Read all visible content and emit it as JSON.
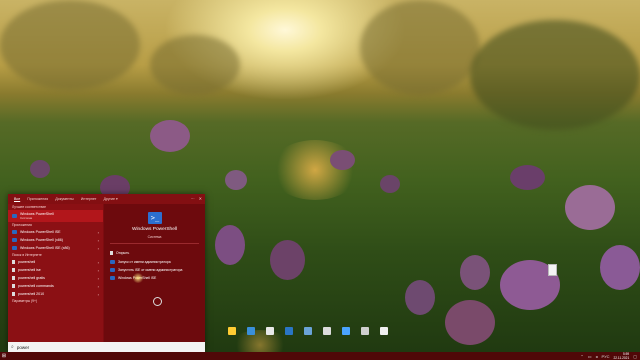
{
  "start_menu": {
    "tabs": [
      "Все",
      "Приложения",
      "Документы",
      "Интернет",
      "Другие ▾"
    ],
    "sections": {
      "best_match": "Лучшее соответствие",
      "apps": "Приложения",
      "web": "Поиск в Интернете",
      "settings": "Параметры (9+)"
    },
    "best_match": {
      "name": "Windows PowerShell",
      "type": "Система"
    },
    "apps": [
      "Windows PowerShell ISE",
      "Windows PowerShell (x86)",
      "Windows PowerShell ISE (x86)"
    ],
    "web": [
      "powershell",
      "powershell ise",
      "powershell gratis",
      "powershell commands",
      "powershell 2010"
    ],
    "preview": {
      "name": "Windows PowerShell",
      "type": "Система",
      "actions": [
        "Открыть",
        "Запуск от имени администратора",
        "Запустить ISE от имени администратора",
        "Windows PowerShell ISE"
      ]
    }
  },
  "search": {
    "value": "power"
  },
  "taskbar": {
    "time": "5:59",
    "date": "22.11.2021",
    "lang": "РУС"
  },
  "desktop_icons": [
    "",
    "",
    "",
    "",
    "",
    "",
    "",
    "",
    ""
  ],
  "colors": {
    "menu_bg": "#7d0c10",
    "accent": "#b2161b",
    "taskbar": "#500808"
  }
}
